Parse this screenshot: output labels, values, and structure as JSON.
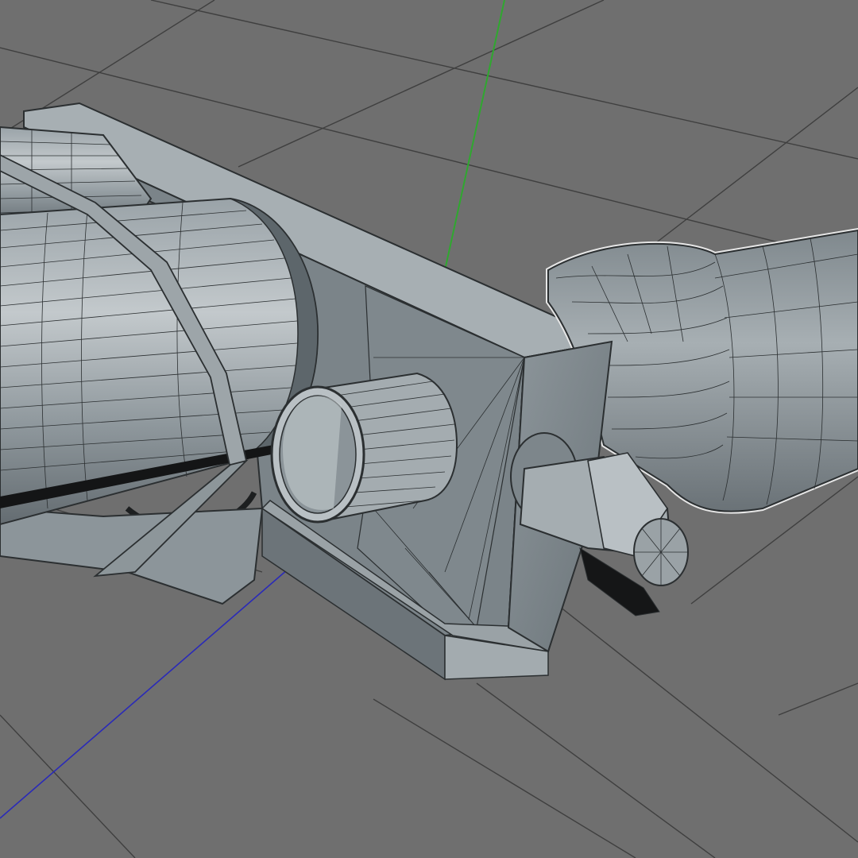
{
  "viewport": {
    "kind": "3d-modeling-viewport",
    "view_mode": "wireframe-on-shaded",
    "grid_visible": true,
    "axes_visible": [
      "y-green",
      "z-blue"
    ],
    "colors": {
      "background": "#6f6f6f",
      "grid": "#3e3e3e",
      "axis_y": "#2fa82f",
      "axis_z": "#2a2ab8",
      "mesh_fill": "#8b9499",
      "mesh_light": "#b7bec2",
      "mesh_dark": "#5d666b",
      "wire": "#2b2f31",
      "selection_outline": "#e6e6e6"
    }
  },
  "model": {
    "parts": [
      "frame-bracket",
      "main-tube",
      "rear-tube",
      "strap",
      "short-sleeve",
      "mount-plate",
      "lever-knob",
      "selected-flared-part"
    ]
  }
}
